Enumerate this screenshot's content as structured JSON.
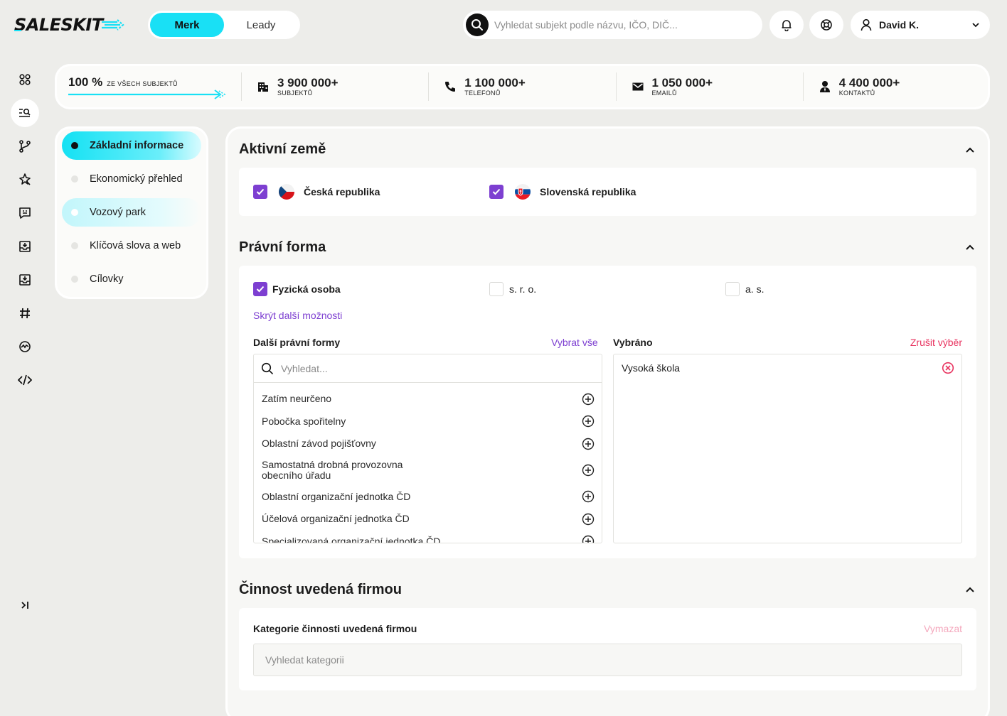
{
  "brand": {
    "logo_text": "SALESKIT"
  },
  "mode_toggle": {
    "merk": "Merk",
    "leady": "Leady"
  },
  "search": {
    "placeholder": "Vyhledat subjekt podle názvu, IČO, DIČ..."
  },
  "user": {
    "name": "David K."
  },
  "stats": {
    "percent": "100 %",
    "percent_label": "ze všech subjektů",
    "items": [
      {
        "value": "3 900 000+",
        "label": "subjektů",
        "icon": "building-icon"
      },
      {
        "value": "1 100 000+",
        "label": "telefonů",
        "icon": "phone-icon"
      },
      {
        "value": "1 050 000+",
        "label": "emailů",
        "icon": "mail-icon"
      },
      {
        "value": "4 400 000+",
        "label": "kontaktů",
        "icon": "person-icon"
      }
    ]
  },
  "section_nav": [
    {
      "label": "Základní informace",
      "state": "active"
    },
    {
      "label": "Ekonomický přehled",
      "state": "default"
    },
    {
      "label": "Vozový park",
      "state": "hover"
    },
    {
      "label": "Klíčová slova a web",
      "state": "default"
    },
    {
      "label": "Cílovky",
      "state": "default"
    }
  ],
  "sections": {
    "countries": {
      "title": "Aktivní země",
      "items": [
        {
          "label": "Česká republika",
          "checked": true
        },
        {
          "label": "Slovenská republika",
          "checked": true
        }
      ]
    },
    "legal_form": {
      "title": "Právní forma",
      "options": [
        {
          "label": "Fyzická osoba",
          "checked": true
        },
        {
          "label": "s. r. o.",
          "checked": false
        },
        {
          "label": "a. s.",
          "checked": false
        }
      ],
      "toggle_more": "Skrýt další možnosti",
      "more_title": "Další právní formy",
      "select_all": "Vybrat vše",
      "list_search_placeholder": "Vyhledat...",
      "list": [
        "Zatím neurčeno",
        "Pobočka spořitelny",
        "Oblastní závod pojišťovny",
        "Samostatná drobná provozovna obecního úřadu",
        "Oblastní organizační jednotka ČD",
        "Účelová organizační jednotka ČD",
        "Specializovaná organizační jednotka ČD"
      ],
      "selected_title": "Vybráno",
      "clear_selection": "Zrušit výběr",
      "selected": [
        "Vysoká škola"
      ]
    },
    "activity": {
      "title": "Činnost uvedená firmou",
      "field_label": "Kategorie činnosti uvedená firmou",
      "clear": "Vymazat",
      "placeholder": "Vyhledat kategorii"
    }
  },
  "colors": {
    "accent_cyan": "#19e0f5",
    "accent_purple": "#7d3fd1",
    "danger_pink": "#e8335f",
    "background": "#ededea"
  }
}
